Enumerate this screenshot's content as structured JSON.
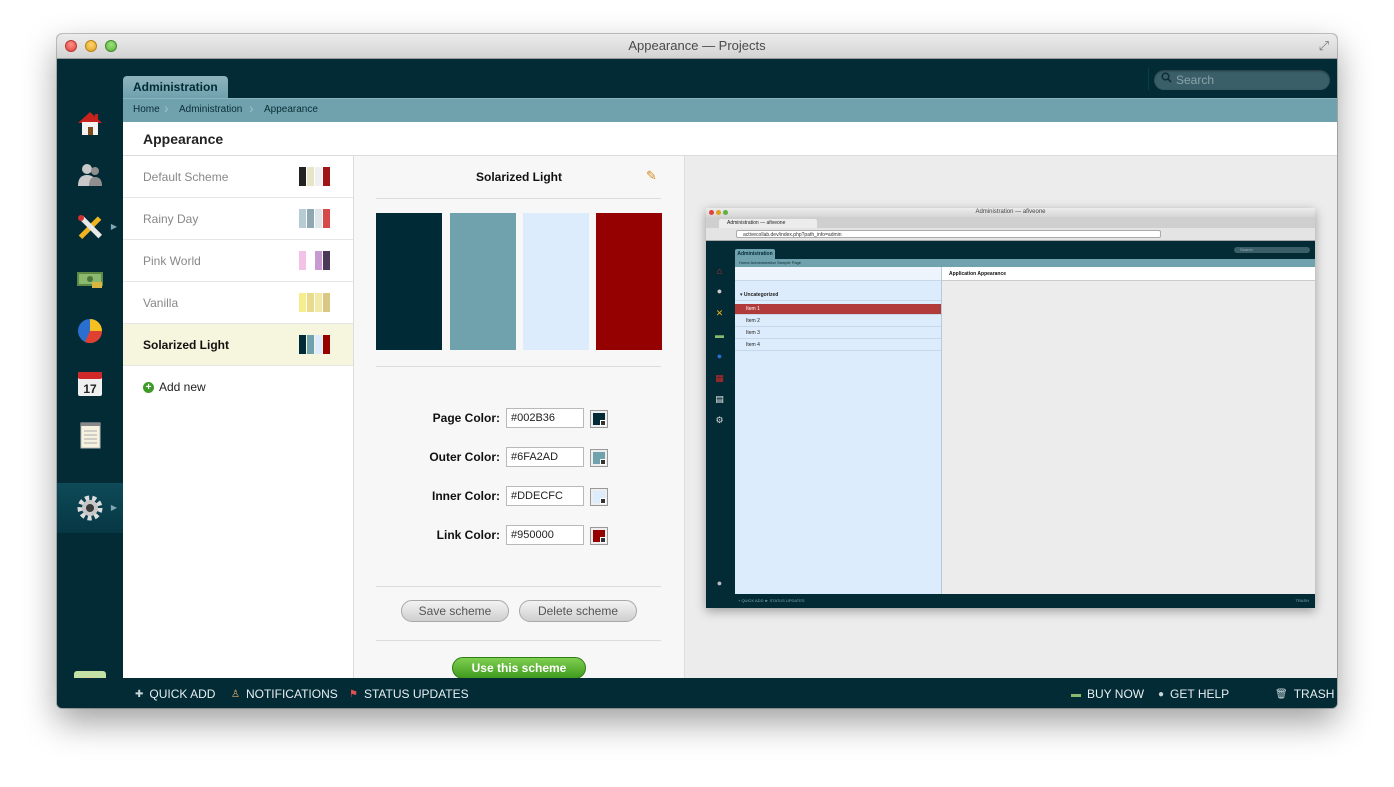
{
  "window": {
    "title": "Appearance — Projects"
  },
  "topbar": {
    "tab_label": "Administration",
    "search_placeholder": "Search"
  },
  "breadcrumb": [
    "Home",
    "Administration",
    "Appearance"
  ],
  "page": {
    "title": "Appearance"
  },
  "schemes": [
    {
      "name": "Default Scheme",
      "swatches": [
        "#222222",
        "#e8e4c6",
        "#f0f0f0",
        "#a01515"
      ]
    },
    {
      "name": "Rainy Day",
      "swatches": [
        "#b7cbd2",
        "#8fa7b0",
        "#dfe6e9",
        "#d64a4a"
      ]
    },
    {
      "name": "Pink World",
      "swatches": [
        "#f2c2e7",
        "#ffffff",
        "#c79ad1",
        "#4a3a57"
      ]
    },
    {
      "name": "Vanilla",
      "swatches": [
        "#f4ee8e",
        "#e8dc8c",
        "#f2e9a6",
        "#d9c784"
      ]
    },
    {
      "name": "Solarized Light",
      "swatches": [
        "#002b36",
        "#6fa2ad",
        "#ddecfc",
        "#950000"
      ],
      "selected": true
    }
  ],
  "add_new_label": "Add new",
  "editor": {
    "title": "Solarized Light",
    "colors": [
      "#002b36",
      "#6fa2ad",
      "#ddecfc",
      "#950000"
    ],
    "fields": [
      {
        "label": "Page Color:",
        "value": "#002B36",
        "color": "#002b36"
      },
      {
        "label": "Outer Color:",
        "value": "#6FA2AD",
        "color": "#6fa2ad"
      },
      {
        "label": "Inner Color:",
        "value": "#DDECFC",
        "color": "#ddecfc"
      },
      {
        "label": "Link Color:",
        "value": "#950000",
        "color": "#950000"
      }
    ],
    "save_label": "Save scheme",
    "delete_label": "Delete scheme",
    "use_label": "Use this scheme"
  },
  "preview": {
    "window_title": "Administration — afiveone",
    "tab_title": "Administration — afiveone",
    "url": "activecollab.dev/index.php?path_info=admin",
    "admin_tab": "Administration",
    "search": "Search",
    "crumbs": "Home    Administration    Sample Page",
    "main_title": "Application Appearance",
    "group": "Uncategorized",
    "items": [
      "Item 1",
      "Item 2",
      "Item 3",
      "Item 4"
    ],
    "footer_left": "+ QUICK ADD    ► STATUS UPDATES",
    "footer_right": "TRASH"
  },
  "footer": {
    "quick_add": "QUICK ADD",
    "notifications": "NOTIFICATIONS",
    "status_updates": "STATUS UPDATES",
    "buy_now": "BUY NOW",
    "get_help": "GET HELP",
    "trash": "TRASH"
  },
  "sidebar_icons": [
    "home-icon",
    "people-icon",
    "tools-icon",
    "money-icon",
    "pie-chart-icon",
    "calendar-icon",
    "notebook-icon",
    "settings-icon",
    "avatar"
  ],
  "calendar_day": "17"
}
